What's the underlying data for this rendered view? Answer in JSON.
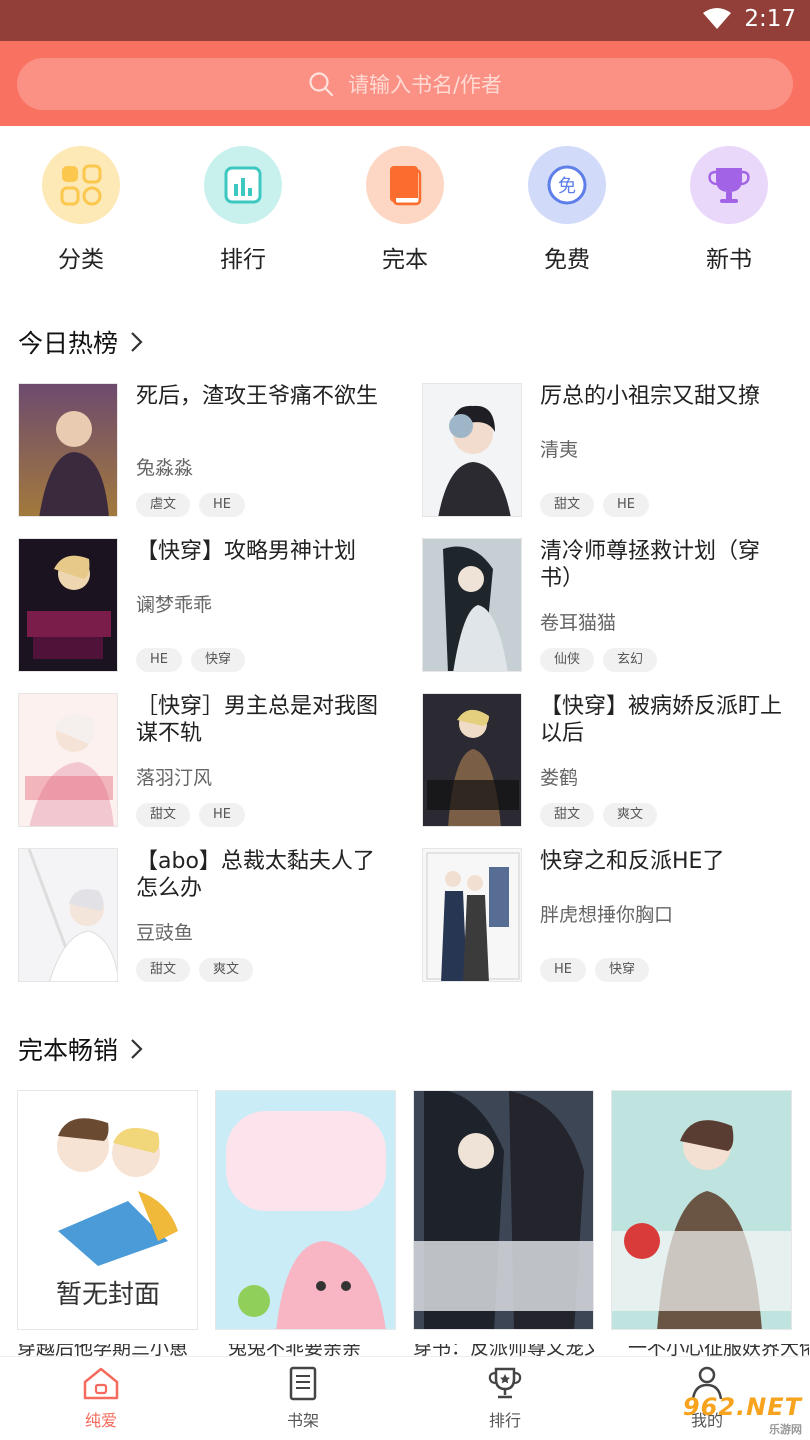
{
  "status_bar": {
    "time": "2:17"
  },
  "search": {
    "placeholder": "请输入书名/作者"
  },
  "quick_nav": [
    {
      "label": "分类",
      "icon": "category-icon",
      "color": "#fde9b5"
    },
    {
      "label": "排行",
      "icon": "ranking-icon",
      "color": "#c8f1ee"
    },
    {
      "label": "完本",
      "icon": "complete-book-icon",
      "color": "#fdd7c4"
    },
    {
      "label": "免费",
      "icon": "free-icon",
      "color": "#d1daf9"
    },
    {
      "label": "新书",
      "icon": "trophy-icon",
      "color": "#ead8fa"
    }
  ],
  "hot_list": {
    "title": "今日热榜",
    "items": [
      {
        "title": "死后，渣攻王爷痛不欲生",
        "author": "兔淼淼",
        "tags": [
          "虐文",
          "HE"
        ]
      },
      {
        "title": "厉总的小祖宗又甜又撩",
        "author": "清夷",
        "tags": [
          "甜文",
          "HE"
        ]
      },
      {
        "title": "【快穿】攻略男神计划",
        "author": "谰梦乖乖",
        "tags": [
          "HE",
          "快穿"
        ]
      },
      {
        "title": "清冷师尊拯救计划（穿书）",
        "author": "卷耳猫猫",
        "tags": [
          "仙侠",
          "玄幻"
        ]
      },
      {
        "title": "［快穿］男主总是对我图谋不轨",
        "author": "落羽汀风",
        "tags": [
          "甜文",
          "HE"
        ]
      },
      {
        "title": "【快穿】被病娇反派盯上以后",
        "author": "娄鹤",
        "tags": [
          "甜文",
          "爽文"
        ]
      },
      {
        "title": "【abo】总裁太黏夫人了怎么办",
        "author": "豆豉鱼",
        "tags": [
          "甜文",
          "爽文"
        ]
      },
      {
        "title": "快穿之和反派HE了",
        "author": "胖虎想捶你胸口",
        "tags": [
          "HE",
          "快穿"
        ]
      }
    ]
  },
  "complete": {
    "title": "完本畅销",
    "no_cover_text": "暂无封面",
    "items": [
      {
        "title": "穿越后他孕期三小崽"
      },
      {
        "title": "兔兔不乖要亲亲"
      },
      {
        "title": "穿书：反派师尊又宠又撩"
      },
      {
        "title": "一不小心征服妖界大佬"
      }
    ]
  },
  "bottom_nav": [
    {
      "label": "纯爱",
      "icon": "home-icon",
      "active": true
    },
    {
      "label": "书架",
      "icon": "bookshelf-icon",
      "active": false
    },
    {
      "label": "排行",
      "icon": "trophy-icon",
      "active": false
    },
    {
      "label": "我的",
      "icon": "profile-icon",
      "active": false
    }
  ],
  "watermark": {
    "text": "962.NET",
    "subtext": "乐游网"
  },
  "colors": {
    "accent": "#f97161",
    "status_bar": "#923f39",
    "active_nav": "#f56a5c"
  }
}
